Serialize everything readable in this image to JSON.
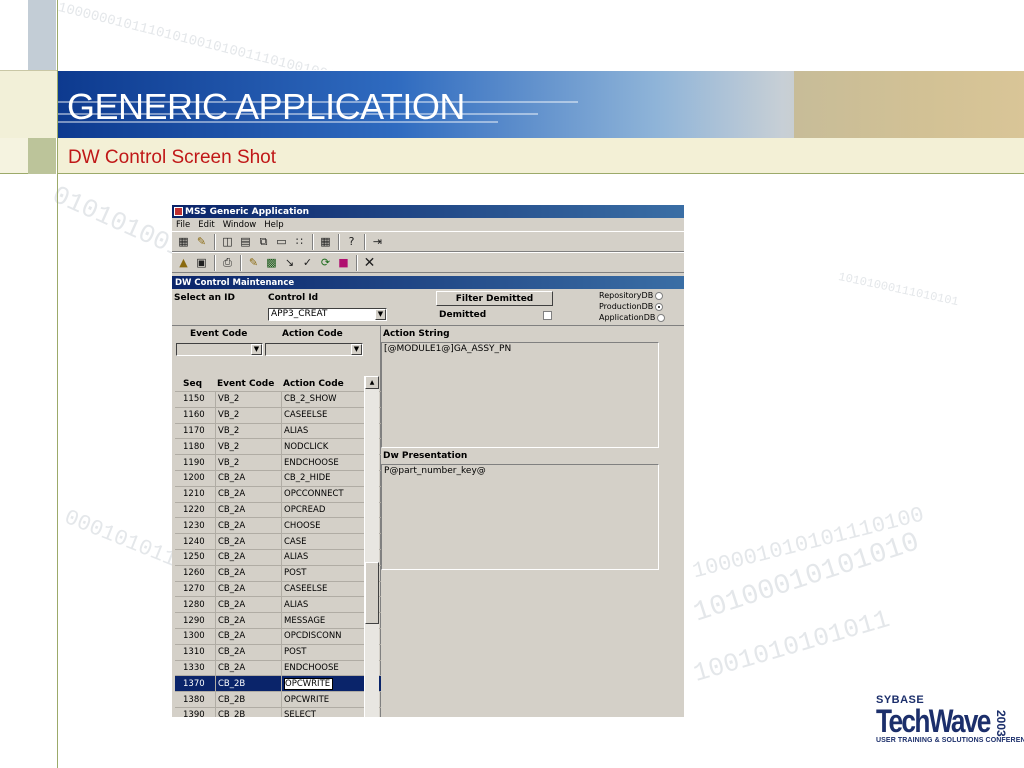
{
  "slide": {
    "title": "GENERIC APPLICATION",
    "subtitle": "DW Control Screen Shot",
    "logo": {
      "brand": "SYBASE",
      "product": "TechWave",
      "year": "2003",
      "tagline": "USER TRAINING & SOLUTIONS CONFERENCE"
    }
  },
  "app": {
    "window_title": "MSS Generic Application",
    "menu": [
      "File",
      "Edit",
      "Window",
      "Help"
    ],
    "toolbar1_icons": [
      "properties-icon",
      "edit-icon",
      "columns-icon",
      "rows-icon",
      "cascade-icon",
      "window-icon",
      "grid-icon",
      "table-icon",
      "help-icon",
      "exit-icon"
    ],
    "toolbar2_icons": [
      "retrieve-icon",
      "save-icon",
      "print-icon",
      "new-icon",
      "insert-icon",
      "delete-icon",
      "tools-icon",
      "refresh-icon",
      "color-icon",
      "close-icon"
    ],
    "child_window_title": "DW Control Maintenance",
    "select_id_label": "Select an ID",
    "control_id_label": "Control Id",
    "control_id_value": "APP3_CREAT",
    "filter_button": "Filter Demitted",
    "demitted_label": "Demitted",
    "radios": [
      {
        "label": "RepositoryDB",
        "checked": false
      },
      {
        "label": "ProductionDB",
        "checked": true
      },
      {
        "label": "ApplicationDB",
        "checked": false
      }
    ],
    "event_code_label": "Event Code",
    "action_code_label": "Action Code",
    "action_string_label": "Action String",
    "action_string_value": "[@MODULE1@]GA_ASSY_PN",
    "dw_presentation_label": "Dw Presentation",
    "dw_presentation_value": "P@part_number_key@",
    "grid": {
      "columns": [
        "Seq",
        "Event Code",
        "Action Code"
      ],
      "rows": [
        [
          "1150",
          "VB_2",
          "CB_2_SHOW"
        ],
        [
          "1160",
          "VB_2",
          "CASEELSE"
        ],
        [
          "1170",
          "VB_2",
          "ALIAS"
        ],
        [
          "1180",
          "VB_2",
          "NODCLICK"
        ],
        [
          "1190",
          "VB_2",
          "ENDCHOOSE"
        ],
        [
          "1200",
          "CB_2A",
          "CB_2_HIDE"
        ],
        [
          "1210",
          "CB_2A",
          "OPCCONNECT"
        ],
        [
          "1220",
          "CB_2A",
          "OPCREAD"
        ],
        [
          "1230",
          "CB_2A",
          "CHOOSE"
        ],
        [
          "1240",
          "CB_2A",
          "CASE"
        ],
        [
          "1250",
          "CB_2A",
          "ALIAS"
        ],
        [
          "1260",
          "CB_2A",
          "POST"
        ],
        [
          "1270",
          "CB_2A",
          "CASEELSE"
        ],
        [
          "1280",
          "CB_2A",
          "ALIAS"
        ],
        [
          "1290",
          "CB_2A",
          "MESSAGE"
        ],
        [
          "1300",
          "CB_2A",
          "OPCDISCONN"
        ],
        [
          "1310",
          "CB_2A",
          "POST"
        ],
        [
          "1330",
          "CB_2A",
          "ENDCHOOSE"
        ],
        [
          "1370",
          "CB_2B",
          "OPCWRITE"
        ],
        [
          "1380",
          "CB_2B",
          "OPCWRITE"
        ],
        [
          "1390",
          "CB_2B",
          "SELECT"
        ]
      ],
      "selected_index": 18
    }
  },
  "colors": {
    "title_blue": "#0d3a8f",
    "subtitle_red": "#c01818",
    "win_titlebar": "#0a246a",
    "win_face": "#d4d0c8"
  }
}
